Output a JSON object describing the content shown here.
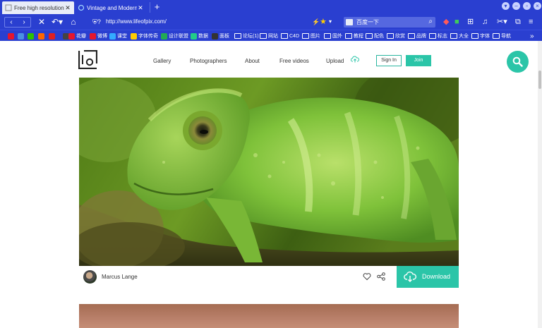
{
  "browser": {
    "tabs": [
      {
        "title": "Free high resolution ph...",
        "active": true
      },
      {
        "title": "Vintage and Modern Fr...",
        "active": false
      }
    ],
    "newtab_label": "+",
    "url": "http://www.lifeofpix.com/",
    "search_placeholder": "百度一下",
    "bookmarks": [
      {
        "label": "",
        "icon": "weibo-icon",
        "color": "#e6162d"
      },
      {
        "label": "",
        "icon": "app-icon",
        "color": "#4a90e2"
      },
      {
        "label": "",
        "icon": "wechat-icon",
        "color": "#2dc100"
      },
      {
        "label": "",
        "icon": "sohu-icon",
        "color": "#ff6600"
      },
      {
        "label": "",
        "icon": "stop-icon",
        "color": "#e02020"
      },
      {
        "label": "",
        "icon": "music-icon",
        "color": "#444444"
      },
      {
        "label": "花瓣",
        "icon": "huaban-icon",
        "color": "#e6162d"
      },
      {
        "label": "微博",
        "icon": "weibo-icon",
        "color": "#e6162d"
      },
      {
        "label": "课堂",
        "icon": "class-icon",
        "color": "#33aaff"
      },
      {
        "label": "字体传奇",
        "icon": "font-icon",
        "color": "#ffcc00"
      },
      {
        "label": "设计联盟",
        "icon": "design-icon",
        "color": "#22aa55"
      },
      {
        "label": "数据",
        "icon": "data-icon",
        "color": "#22cc88"
      },
      {
        "label": "面板",
        "icon": "bt-icon",
        "color": "#333333"
      },
      {
        "label": "论坛(1)",
        "icon": "folder-icon"
      },
      {
        "label": "网站",
        "icon": "folder-icon"
      },
      {
        "label": "C4D",
        "icon": "folder-icon"
      },
      {
        "label": "图片",
        "icon": "folder-icon"
      },
      {
        "label": "国外",
        "icon": "folder-icon"
      },
      {
        "label": "教程",
        "icon": "folder-icon"
      },
      {
        "label": "配色",
        "icon": "folder-icon"
      },
      {
        "label": "欣赏",
        "icon": "folder-icon"
      },
      {
        "label": "品牌",
        "icon": "folder-icon"
      },
      {
        "label": "标志",
        "icon": "folder-icon"
      },
      {
        "label": "大全",
        "icon": "folder-icon"
      },
      {
        "label": "字体",
        "icon": "folder-icon"
      },
      {
        "label": "导航",
        "icon": "folder-icon"
      }
    ],
    "bookmarks_overflow": "»"
  },
  "site": {
    "nav": {
      "gallery": "Gallery",
      "photographers": "Photographers",
      "about": "About",
      "free_videos": "Free videos",
      "upload": "Upload"
    },
    "signin": "Sign In",
    "join": "Join",
    "accent": "#2bc5a8"
  },
  "photo": {
    "author": "Marcus Lange",
    "download_label": "Download"
  }
}
